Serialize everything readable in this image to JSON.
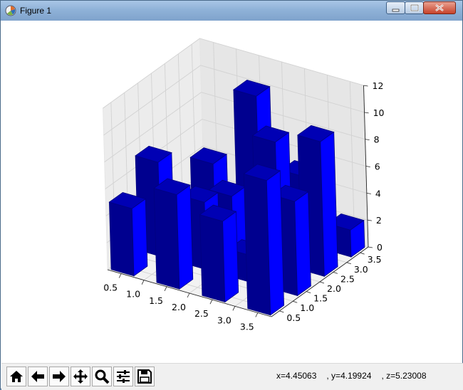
{
  "window": {
    "title": "Figure 1"
  },
  "titlebar_buttons": {
    "minimize": "minimize",
    "maximize": "maximize",
    "close": "close"
  },
  "toolbar": {
    "buttons": [
      {
        "name": "home",
        "icon": "home-icon"
      },
      {
        "name": "back",
        "icon": "arrow-left-icon"
      },
      {
        "name": "forward",
        "icon": "arrow-right-icon"
      },
      {
        "name": "pan",
        "icon": "move-icon"
      },
      {
        "name": "zoom",
        "icon": "magnifier-icon"
      },
      {
        "name": "subplots",
        "icon": "sliders-icon"
      },
      {
        "name": "save",
        "icon": "floppy-icon"
      }
    ],
    "coords": {
      "x": "x=4.45063",
      "y": ", y=4.19924",
      "z": ", z=5.23008"
    }
  },
  "chart_data": {
    "type": "bar3d",
    "bar_color": "#0000ff",
    "x_ticks": [
      "0.5",
      "1.0",
      "1.5",
      "2.0",
      "2.5",
      "3.0",
      "3.5"
    ],
    "y_ticks": [
      "0.5",
      "1.0",
      "1.5",
      "2.0",
      "2.5",
      "3.0",
      "3.5"
    ],
    "z_ticks": [
      "0",
      "2",
      "4",
      "6",
      "8",
      "10",
      "12"
    ],
    "xlim": [
      0.2,
      3.8
    ],
    "ylim": [
      0.2,
      3.8
    ],
    "zlim": [
      0,
      12
    ],
    "x_positions": [
      0.5,
      1.5,
      2.5,
      3.5
    ],
    "y_positions": [
      0.5,
      1.5,
      2.5,
      3.5
    ],
    "bar_width": 0.5,
    "heights": [
      [
        5.0,
        7.0,
        1.0,
        4.0
      ],
      [
        7.0,
        5.0,
        4.0,
        10.0
      ],
      [
        6.0,
        2.0,
        9.0,
        5.0
      ],
      [
        10.0,
        7.0,
        10.0,
        2.0
      ]
    ],
    "grid": true
  }
}
